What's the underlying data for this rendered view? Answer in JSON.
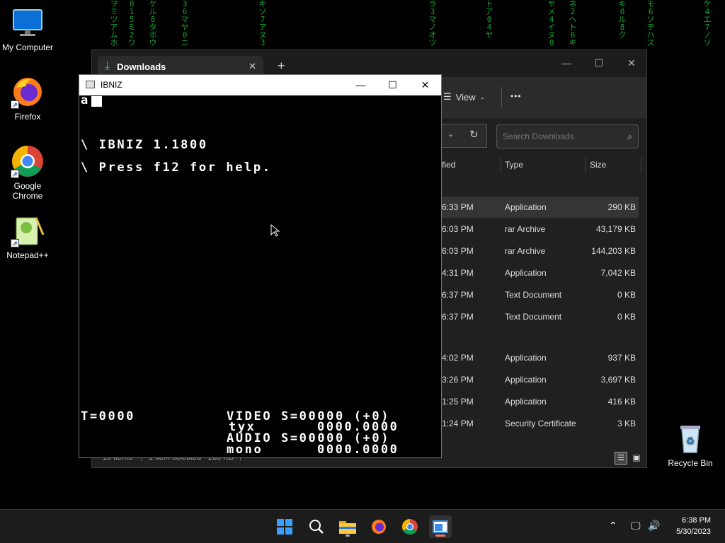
{
  "rain": [
    {
      "text": "ヲ ミ ツ ア ム ホ"
    },
    {
      "text": "0 1 5 ミ 2 ワ"
    },
    {
      "text": "ケ ル 8 タ ホ ウ"
    },
    {
      "text": "3 6 マ ヤ 0 ニ"
    },
    {
      "text": "キ ソ 7 ア ヌ 3"
    },
    {
      "text": "ラ 3 マ ノ オ ツ"
    },
    {
      "text": "ト ア 0 4 ヤ"
    },
    {
      "text": "ヤ メ 4 イ ヌ 0"
    },
    {
      "text": "ネ 2 ヘ ト 6 キ"
    },
    {
      "text": "キ 0 ル 8 ク"
    },
    {
      "text": "モ 6 ソ テ ハ ス"
    },
    {
      "text": "ケ 4 エ 7 ノ ソ"
    }
  ],
  "desktop": {
    "icons": [
      {
        "label": "My Computer"
      },
      {
        "label": "Firefox"
      },
      {
        "label": "Google Chrome"
      },
      {
        "label": "Notepad++"
      },
      {
        "label": "Recycle Bin"
      }
    ]
  },
  "explorer": {
    "tab_title": "Downloads",
    "tab_close": "✕",
    "new_tab": "+",
    "view_label": "View",
    "more_label": "•••",
    "search_placeholder": "Search Downloads",
    "columns": {
      "modified": "fied",
      "type": "Type",
      "size": "Size"
    },
    "rows": [
      {
        "time": "6:33 PM",
        "type": "Application",
        "size": "290 KB"
      },
      {
        "time": "6:03 PM",
        "type": "rar Archive",
        "size": "43,179 KB"
      },
      {
        "time": "6:03 PM",
        "type": "rar Archive",
        "size": "144,203 KB"
      },
      {
        "time": "4:31 PM",
        "type": "Application",
        "size": "7,042 KB"
      },
      {
        "time": "6:37 PM",
        "type": "Text Document",
        "size": "0 KB"
      },
      {
        "time": "6:37 PM",
        "type": "Text Document",
        "size": "0 KB"
      },
      {
        "time": "4:02 PM",
        "type": "Application",
        "size": "937 KB"
      },
      {
        "time": "3:26 PM",
        "type": "Application",
        "size": "3,697 KB"
      },
      {
        "time": "1:25 PM",
        "type": "Application",
        "size": "416 KB"
      },
      {
        "time": "1:24 PM",
        "type": "Security Certificate",
        "size": "3 KB"
      }
    ],
    "status": {
      "items": "10 items",
      "selected": "1 item selected",
      "selected_size": "289 KB"
    }
  },
  "ibniz": {
    "title": "IBNIZ",
    "input_text": "a",
    "line1": "\\ IBNIZ 1.1800",
    "line2": "\\ Press f12 for help.",
    "stats": {
      "time": "T=0000",
      "video": "VIDEO S=00000 (+0)",
      "tyx": "tyx",
      "video_val": "0000.0000",
      "audio": "AUDIO S=00000 (+0)",
      "mono": "mono",
      "audio_val": "0000.0000"
    }
  },
  "taskbar": {
    "time": "6:38 PM",
    "date": "5/30/2023"
  }
}
